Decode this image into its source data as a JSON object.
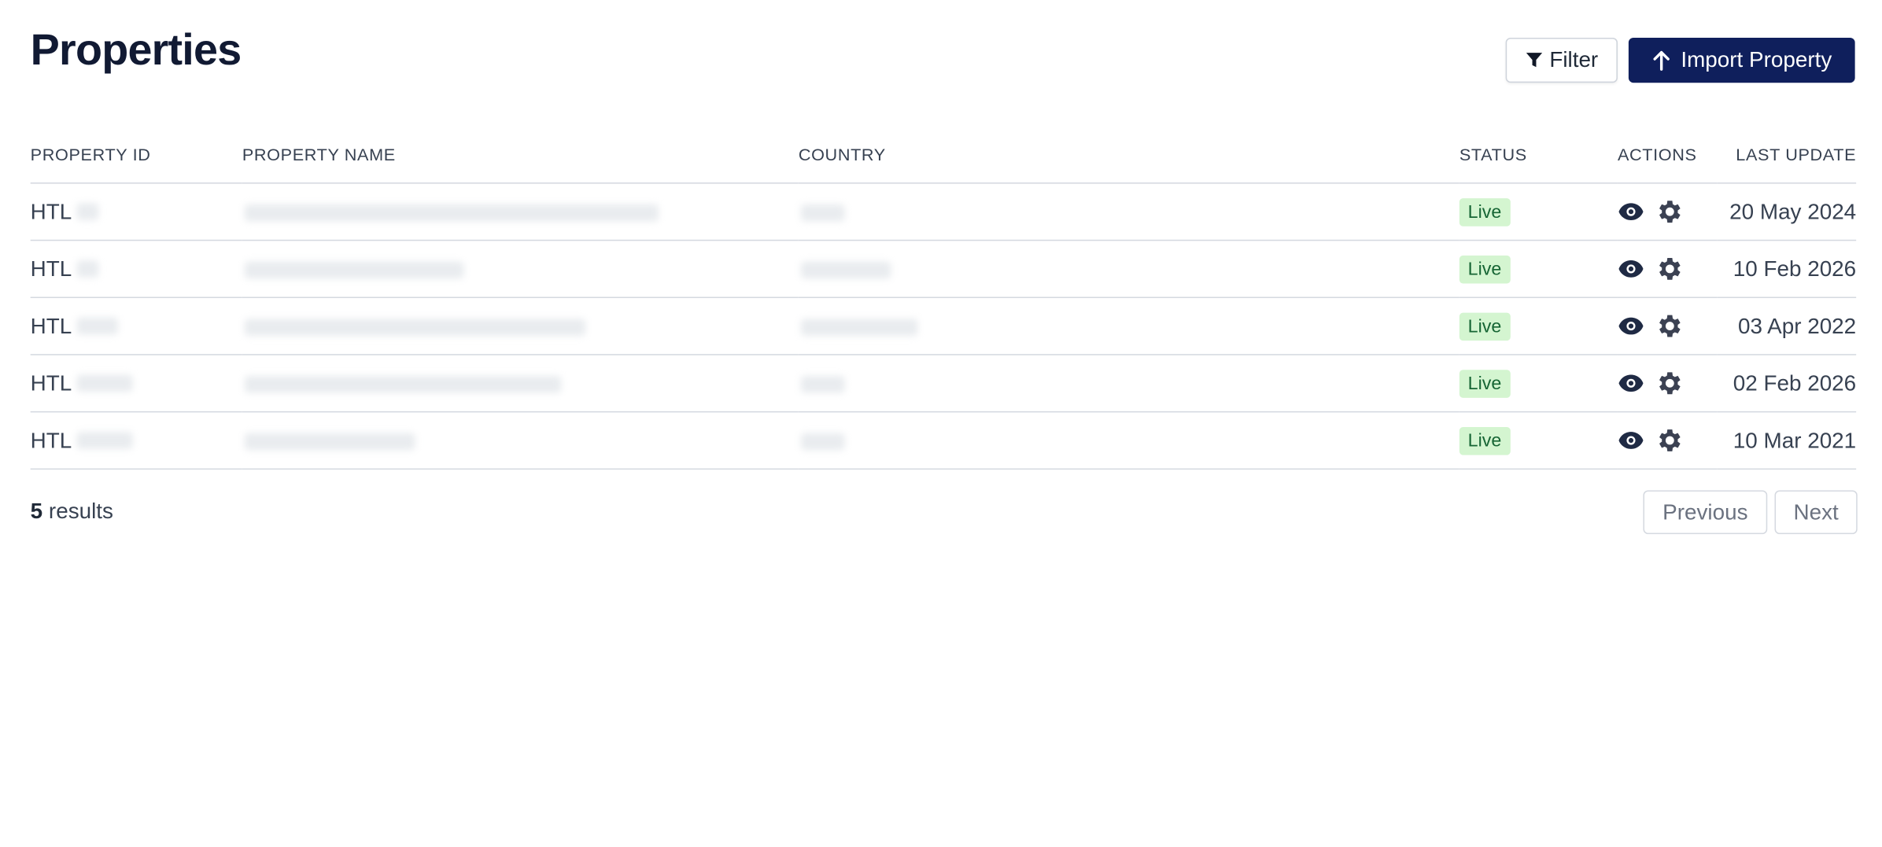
{
  "header": {
    "title": "Properties",
    "filter_label": "Filter",
    "import_label": "Import Property"
  },
  "table": {
    "columns": [
      "PROPERTY ID",
      "PROPERTY NAME",
      "COUNTRY",
      "STATUS",
      "ACTIONS",
      "LAST UPDATE"
    ],
    "rows": [
      {
        "id_prefix": "HTL",
        "status": "Live",
        "last_update": "20 May 2024"
      },
      {
        "id_prefix": "HTL",
        "status": "Live",
        "last_update": "10 Feb 2026"
      },
      {
        "id_prefix": "HTL",
        "status": "Live",
        "last_update": "03 Apr 2022"
      },
      {
        "id_prefix": "HTL",
        "status": "Live",
        "last_update": "02 Feb 2026"
      },
      {
        "id_prefix": "HTL",
        "status": "Live",
        "last_update": "10 Mar 2021"
      }
    ]
  },
  "footer": {
    "count": "5",
    "results_label": "results",
    "previous_label": "Previous",
    "next_label": "Next"
  },
  "colors": {
    "primary_button": "#0f1f5c",
    "status_live_bg": "#d4f5d0",
    "status_live_text": "#166534",
    "icon": "#1f2a44"
  },
  "icons": {
    "filter": "filter-icon",
    "import": "arrow-up-icon",
    "view": "eye-icon",
    "settings": "gear-icon"
  }
}
